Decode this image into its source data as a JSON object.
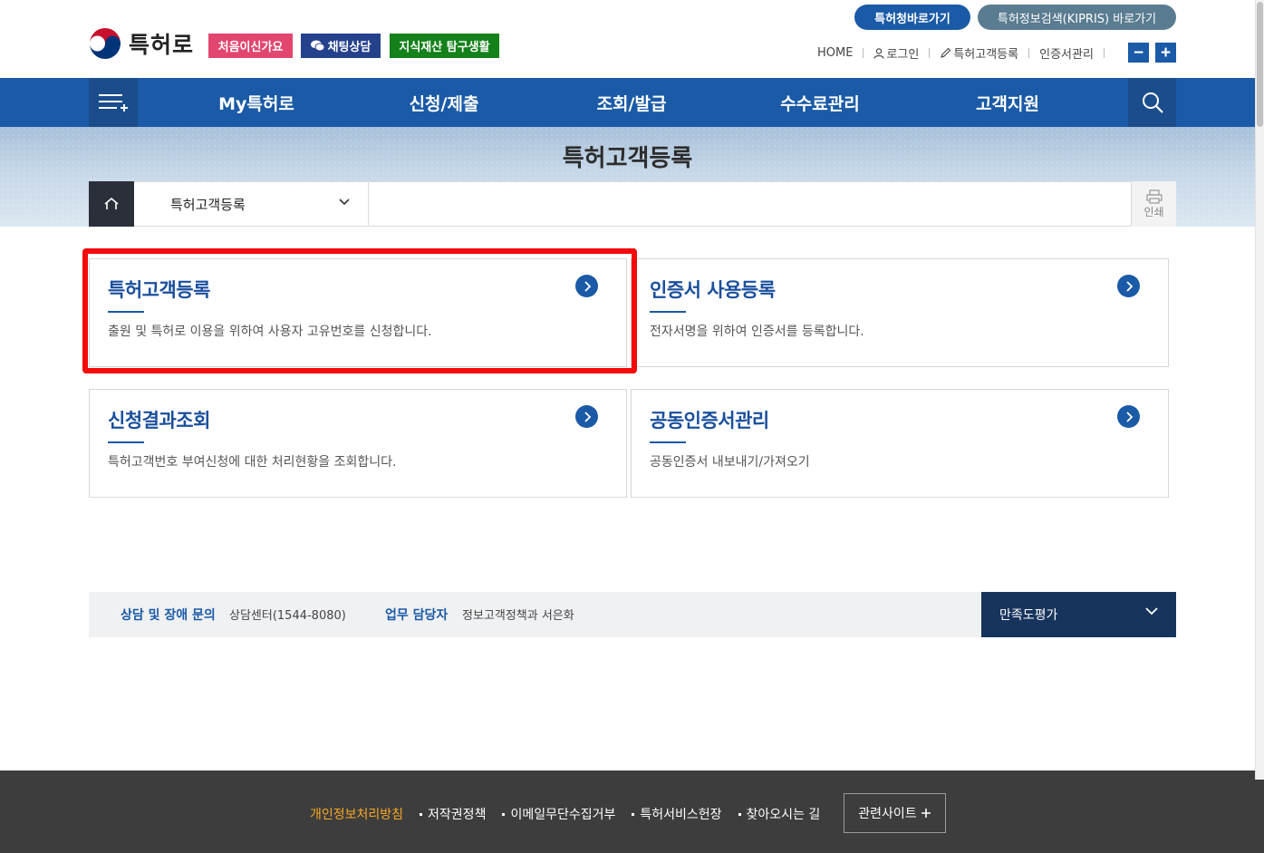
{
  "header": {
    "logo_text": "특허로",
    "tags": {
      "first_time": "처음이신가요",
      "chat": "채팅상담",
      "ip_life": "지식재산 탐구생활"
    },
    "top_links": {
      "kipo": "특허청바로가기",
      "kipris": "특허정보검색(KIPRIS) 바로가기"
    },
    "utility": {
      "home": "HOME",
      "login": "로그인",
      "register": "특허고객등록",
      "cert": "인증서관리"
    },
    "zoom_out": "−",
    "zoom_in": "+"
  },
  "gnb": {
    "items": [
      "My특허로",
      "신청/제출",
      "조회/발급",
      "수수료관리",
      "고객지원"
    ]
  },
  "page": {
    "title": "특허고객등록",
    "location_select": "특허고객등록",
    "print_label": "인쇄"
  },
  "cards": [
    {
      "title": "특허고객등록",
      "desc": "출원 및 특허로 이용을 위하여 사용자 고유번호를 신청합니다."
    },
    {
      "title": "인증서 사용등록",
      "desc": "전자서명을 위하여 인증서를 등록합니다."
    },
    {
      "title": "신청결과조회",
      "desc": "특허고객번호 부여신청에 대한 처리현황을 조회합니다."
    },
    {
      "title": "공동인증서관리",
      "desc": "공동인증서 내보내기/가져오기"
    }
  ],
  "infobar": {
    "contact_label": "상담 및 장애 문의",
    "contact_value": "상담센터(1544-8080)",
    "manager_label": "업무 담당자",
    "manager_value": "정보고객정책과 서은화",
    "satisfaction": "만족도평가"
  },
  "footer": {
    "links": [
      "개인정보처리방침",
      "저작권정책",
      "이메일무단수집거부",
      "특허서비스헌장",
      "찾아오시는 길"
    ],
    "related": "관련사이트"
  },
  "colors": {
    "primary": "#1a5aa7",
    "highlight": "#f30a0a",
    "footer_bg": "#3d3d3d",
    "privacy_link": "#f7a823"
  }
}
